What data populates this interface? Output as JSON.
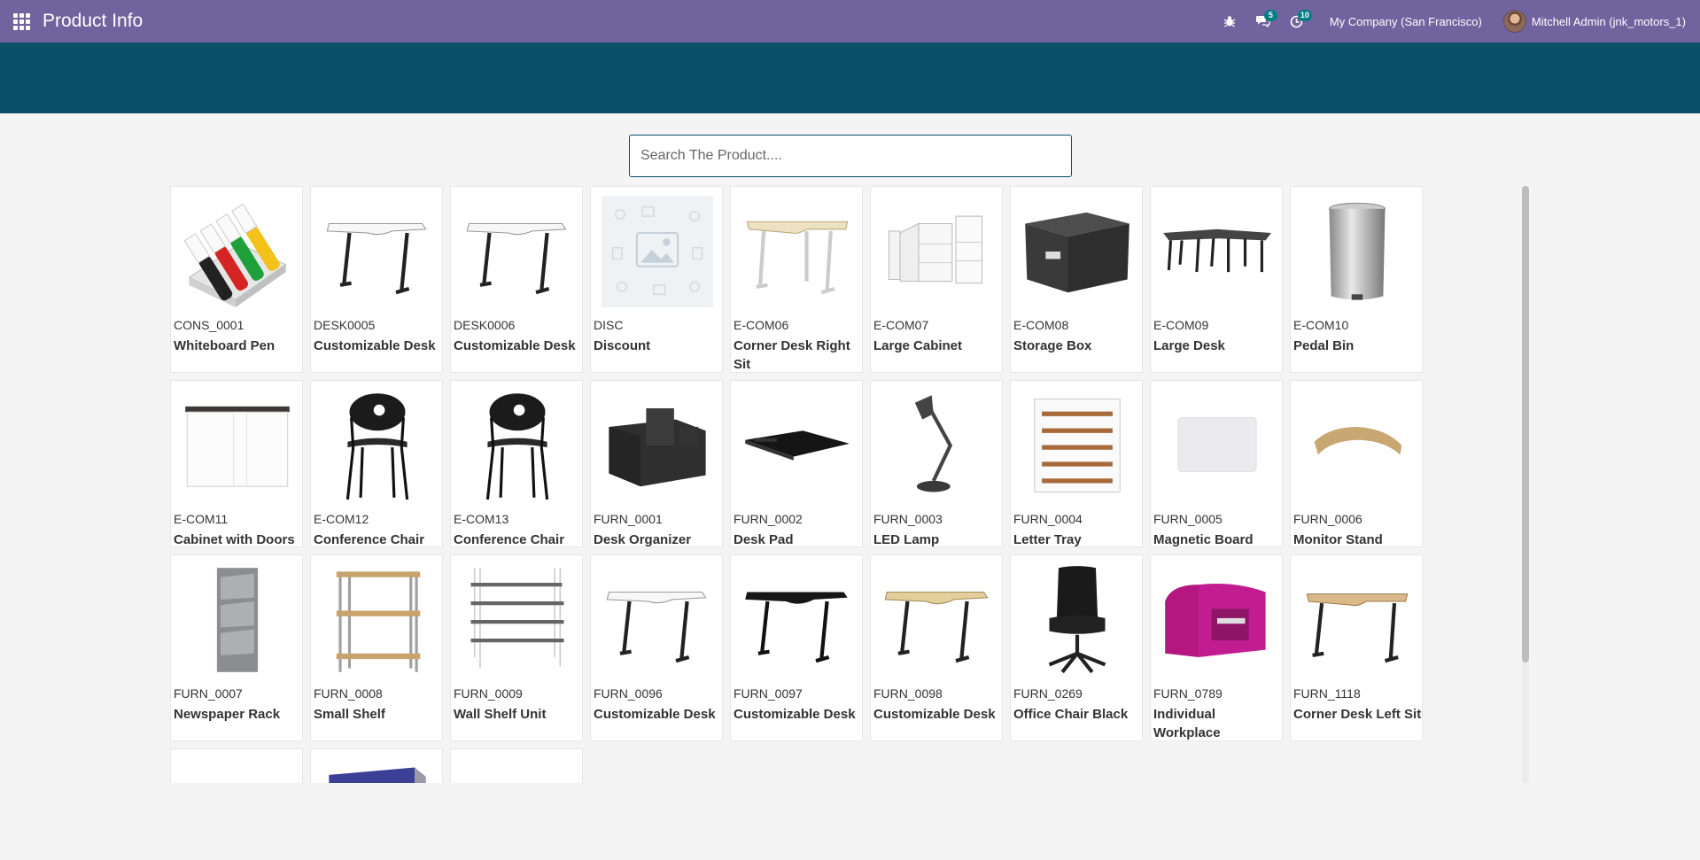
{
  "app": {
    "title": "Product Info"
  },
  "navbar": {
    "messages_count": "5",
    "activities_count": "10",
    "company": "My Company (San Francisco)",
    "user": "Mitchell Admin (jnk_motors_1)"
  },
  "search": {
    "placeholder": "Search The Product...."
  },
  "products": [
    {
      "code": "CONS_0001",
      "name": "Whiteboard Pen",
      "icon": "whiteboard-pens"
    },
    {
      "code": "DESK0005",
      "name": "Customizable Desk",
      "icon": "white-desk"
    },
    {
      "code": "DESK0006",
      "name": "Customizable Desk",
      "icon": "white-desk"
    },
    {
      "code": "DISC",
      "name": "Discount",
      "icon": "placeholder-image"
    },
    {
      "code": "E-COM06",
      "name": "Corner Desk Right Sit",
      "icon": "corner-desk-light"
    },
    {
      "code": "E-COM07",
      "name": "Large Cabinet",
      "icon": "white-cabinet"
    },
    {
      "code": "E-COM08",
      "name": "Storage Box",
      "icon": "storage-box"
    },
    {
      "code": "E-COM09",
      "name": "Large Desk",
      "icon": "large-desk"
    },
    {
      "code": "E-COM10",
      "name": "Pedal Bin",
      "icon": "pedal-bin"
    },
    {
      "code": "E-COM11",
      "name": "Cabinet with Doors",
      "icon": "white-cabinet-doors"
    },
    {
      "code": "E-COM12",
      "name": "Conference Chair",
      "icon": "conference-chair"
    },
    {
      "code": "E-COM13",
      "name": "Conference Chair",
      "icon": "conference-chair"
    },
    {
      "code": "FURN_0001",
      "name": "Desk Organizer",
      "icon": "desk-organizer"
    },
    {
      "code": "FURN_0002",
      "name": "Desk Pad",
      "icon": "desk-pad"
    },
    {
      "code": "FURN_0003",
      "name": "LED Lamp",
      "icon": "led-lamp"
    },
    {
      "code": "FURN_0004",
      "name": "Letter Tray",
      "icon": "letter-tray"
    },
    {
      "code": "FURN_0005",
      "name": "Magnetic Board",
      "icon": "magnetic-board"
    },
    {
      "code": "FURN_0006",
      "name": "Monitor Stand",
      "icon": "monitor-stand"
    },
    {
      "code": "FURN_0007",
      "name": "Newspaper Rack",
      "icon": "newspaper-rack"
    },
    {
      "code": "FURN_0008",
      "name": "Small Shelf",
      "icon": "small-shelf"
    },
    {
      "code": "FURN_0009",
      "name": "Wall Shelf Unit",
      "icon": "wall-shelf"
    },
    {
      "code": "FURN_0096",
      "name": "Customizable Desk",
      "icon": "white-desk"
    },
    {
      "code": "FURN_0097",
      "name": "Customizable Desk",
      "icon": "black-desk"
    },
    {
      "code": "FURN_0098",
      "name": "Customizable Desk",
      "icon": "oak-desk"
    },
    {
      "code": "FURN_0269",
      "name": "Office Chair Black",
      "icon": "office-chair"
    },
    {
      "code": "FURN_0789",
      "name": "Individual Workplace",
      "icon": "individual-workplace"
    },
    {
      "code": "FURN_1118",
      "name": "Corner Desk Left Sit",
      "icon": "corner-desk-oak"
    },
    {
      "code": "",
      "name": "",
      "icon": "none"
    },
    {
      "code": "",
      "name": "",
      "icon": "blue-panel"
    },
    {
      "code": "",
      "name": "",
      "icon": "none"
    }
  ]
}
